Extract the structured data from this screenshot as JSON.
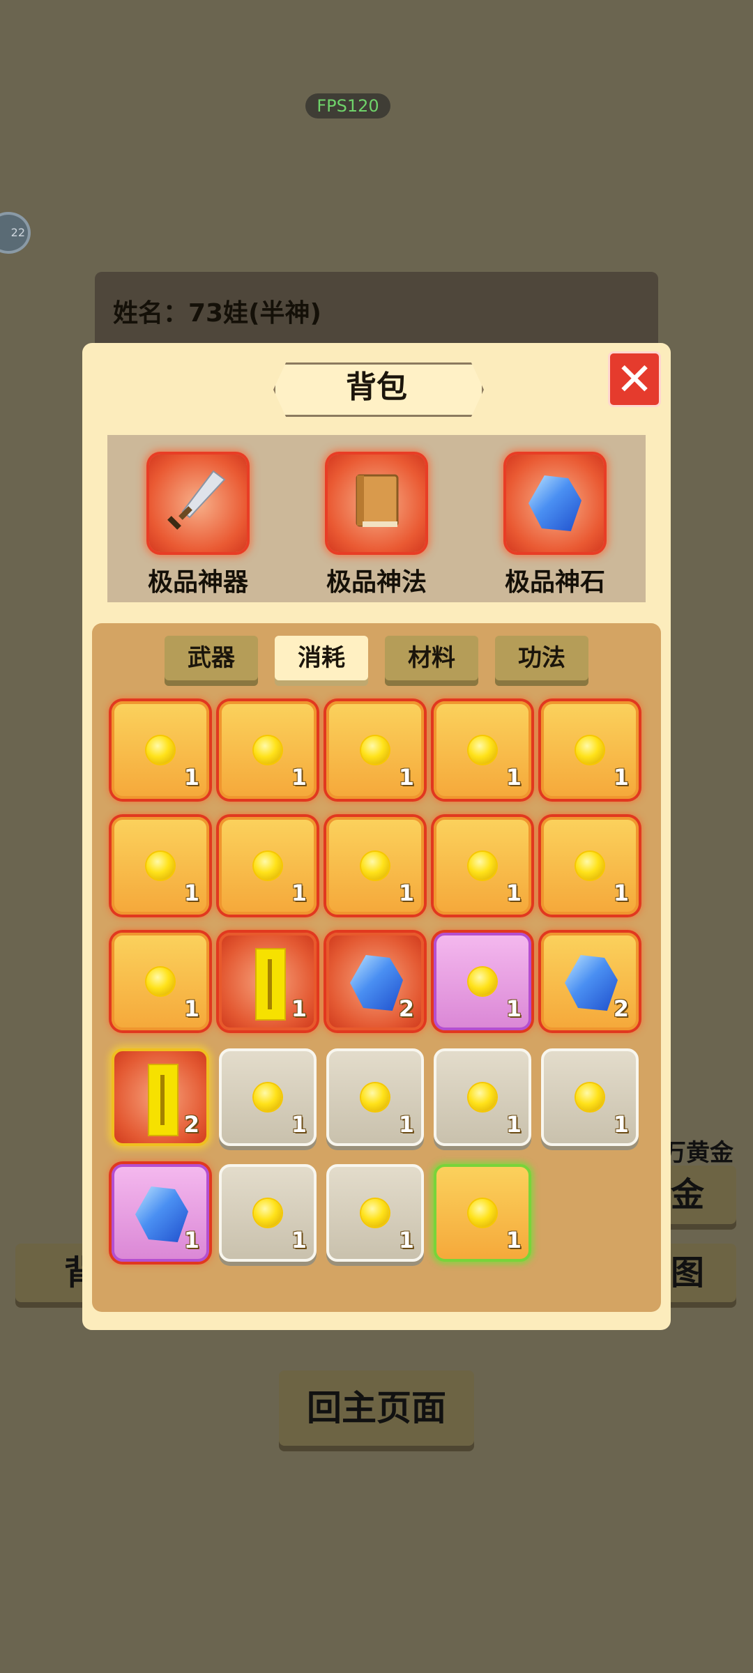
{
  "hud": {
    "fps": "FPS120",
    "side_badge": "22"
  },
  "profile": {
    "name_text": "姓名：73娃(半神)"
  },
  "background": {
    "gold_label": "万黄金",
    "left_btn": "背",
    "right_btn_1": "金",
    "right_btn_2": "图",
    "home_btn": "回主页面"
  },
  "modal": {
    "title": "背包",
    "close_label": "✕",
    "top_items": [
      {
        "label": "极品神器",
        "icon": "sword-icon"
      },
      {
        "label": "极品神法",
        "icon": "book-icon"
      },
      {
        "label": "极品神石",
        "icon": "blue-gem-icon"
      }
    ],
    "tabs": [
      {
        "label": "武器",
        "active": false
      },
      {
        "label": "消耗",
        "active": true
      },
      {
        "label": "材料",
        "active": false
      },
      {
        "label": "功法",
        "active": false
      }
    ],
    "grid": [
      {
        "icon": "gold-coin-icon",
        "qty": "1",
        "rarity": "orange"
      },
      {
        "icon": "gold-coin-icon",
        "qty": "1",
        "rarity": "orange"
      },
      {
        "icon": "gold-coin-icon",
        "qty": "1",
        "rarity": "orange"
      },
      {
        "icon": "gold-coin-icon",
        "qty": "1",
        "rarity": "orange"
      },
      {
        "icon": "gold-coin-icon",
        "qty": "1",
        "rarity": "orange"
      },
      {
        "icon": "gold-coin-icon",
        "qty": "1",
        "rarity": "orange"
      },
      {
        "icon": "gold-coin-icon",
        "qty": "1",
        "rarity": "orange"
      },
      {
        "icon": "gold-coin-icon",
        "qty": "1",
        "rarity": "orange"
      },
      {
        "icon": "gold-coin-icon",
        "qty": "1",
        "rarity": "orange"
      },
      {
        "icon": "gold-coin-icon",
        "qty": "1",
        "rarity": "orange"
      },
      {
        "icon": "gold-coin-icon",
        "qty": "1",
        "rarity": "orange"
      },
      {
        "icon": "talisman-icon",
        "qty": "1",
        "rarity": "red"
      },
      {
        "icon": "blue-gem-icon",
        "qty": "2",
        "rarity": "red"
      },
      {
        "icon": "gold-coin-icon",
        "qty": "1",
        "rarity": "pink"
      },
      {
        "icon": "blue-gem-icon",
        "qty": "2",
        "rarity": "orange"
      },
      {
        "icon": "talisman-icon",
        "qty": "2",
        "rarity": "redgold"
      },
      {
        "icon": "gold-coin-icon",
        "qty": "1",
        "rarity": "white"
      },
      {
        "icon": "gold-coin-icon",
        "qty": "1",
        "rarity": "white"
      },
      {
        "icon": "gold-coin-icon",
        "qty": "1",
        "rarity": "white"
      },
      {
        "icon": "gold-coin-icon",
        "qty": "1",
        "rarity": "white"
      },
      {
        "icon": "blue-gem-icon",
        "qty": "1",
        "rarity": "pink"
      },
      {
        "icon": "gold-coin-icon",
        "qty": "1",
        "rarity": "white"
      },
      {
        "icon": "gold-coin-icon",
        "qty": "1",
        "rarity": "white"
      },
      {
        "icon": "gold-coin-icon",
        "qty": "1",
        "rarity": "green"
      }
    ]
  },
  "colors": {
    "background": "#6b6550",
    "modal_bg": "#fcecbc",
    "inner_panel": "#d4a463",
    "close_red": "#e53b2d",
    "tab_active": "#fff0c2"
  }
}
